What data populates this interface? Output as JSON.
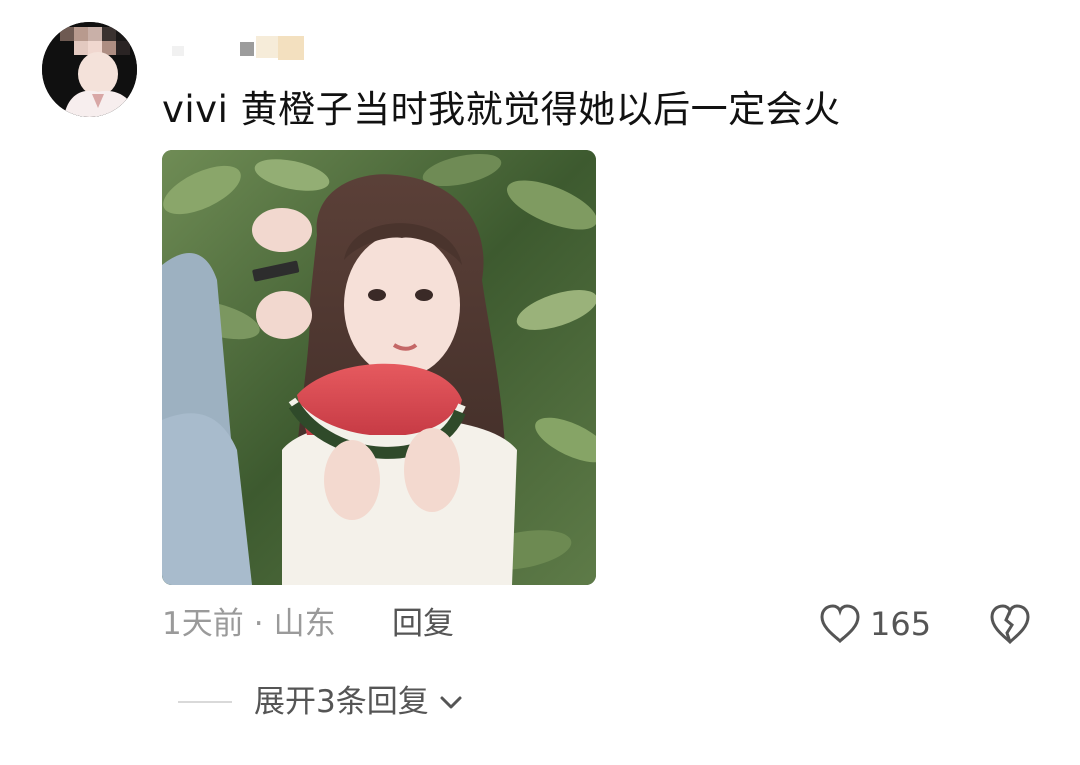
{
  "comment": {
    "text": "vivi 黄橙子当时我就觉得她以后一定会火",
    "time": "1天前",
    "separator": "·",
    "location": "山东",
    "reply_label": "回复",
    "like_count": "165",
    "expand_replies_label": "展开3条回复"
  },
  "icons": {
    "like": "heart-outline-icon",
    "dislike": "broken-heart-icon",
    "expand": "chevron-down-icon"
  },
  "colors": {
    "text_primary": "#111111",
    "text_secondary": "#9a9a9a",
    "action_text": "#555555",
    "divider": "#d9d9d9"
  }
}
